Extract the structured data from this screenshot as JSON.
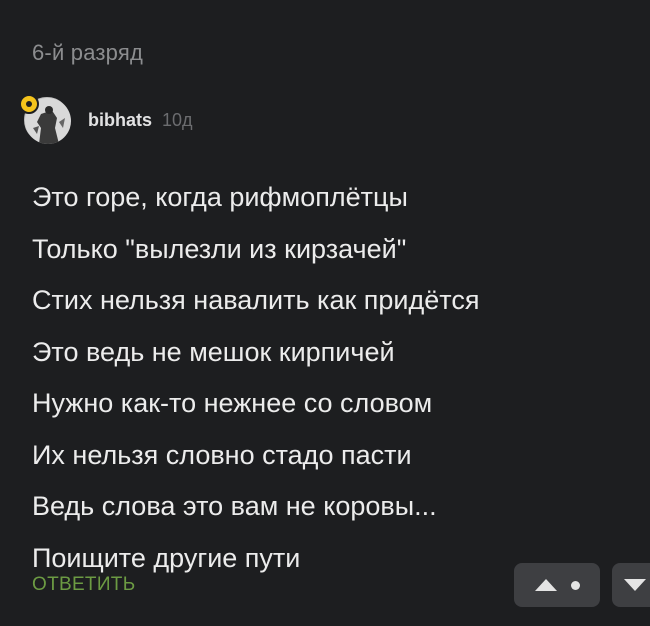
{
  "thread": {
    "title": "6-й разряд"
  },
  "comment": {
    "username": "bibhats",
    "time_ago": "10д",
    "lines": [
      "Это горе, когда рифмоплётцы",
      "Только \"вылезли из кирзачей\"",
      "Стих нельзя навалить как придётся",
      "Это ведь не мешок кирпичей",
      "Нужно как-то нежнее со словом",
      "Их нельзя словно стадо пасти",
      "Ведь слова это вам не коровы...",
      "Поищите другие пути"
    ],
    "reply_label": "ОТВЕТИТЬ"
  },
  "icons": {
    "upvote": "arrow-up-icon",
    "downvote": "arrow-down-icon",
    "badge": "user-badge-icon"
  },
  "colors": {
    "background": "#1d1e20",
    "reply": "#6c9b43",
    "badge": "#f4c31b"
  }
}
